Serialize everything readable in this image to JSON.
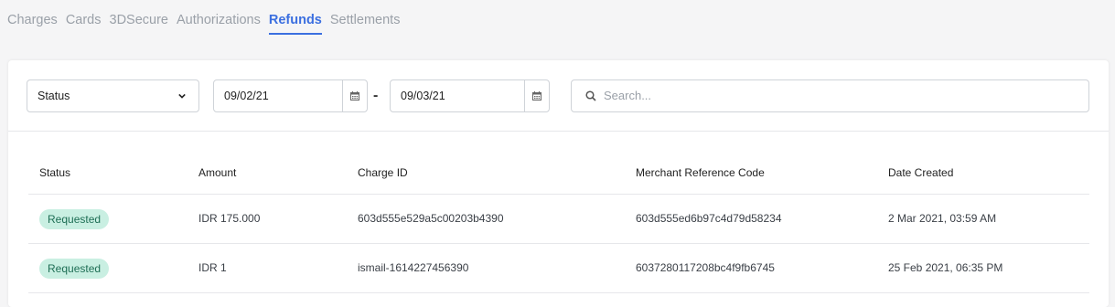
{
  "tabs": [
    "Charges",
    "Cards",
    "3DSecure",
    "Authorizations",
    "Refunds",
    "Settlements"
  ],
  "active_tab": "Refunds",
  "filters": {
    "status_value": "Status",
    "start_date": "09/02/21",
    "date_separator": "-",
    "end_date": "09/03/21",
    "search_placeholder": "Search..."
  },
  "table": {
    "headers": [
      "Status",
      "Amount",
      "Charge ID",
      "Merchant Reference Code",
      "Date Created"
    ],
    "rows": [
      {
        "status": "Requested",
        "amount": "IDR 175.000",
        "charge_id": "603d555e529a5c00203b4390",
        "merchant_ref": "603d555ed6b97c4d79d58234",
        "date_created": "2 Mar 2021, 03:59 AM"
      },
      {
        "status": "Requested",
        "amount": "IDR 1",
        "charge_id": "ismail-1614227456390",
        "merchant_ref": "6037280117208bc4f9fb6745",
        "date_created": "25 Feb 2021, 06:35 PM"
      }
    ]
  },
  "colors": {
    "accent": "#3b6fe0",
    "badge_bg": "#c9efe2",
    "badge_text": "#1e6e55"
  },
  "icons": {
    "select_chevron": "chevron-down-icon",
    "date_picker": "calendar-icon",
    "search": "search-icon"
  }
}
